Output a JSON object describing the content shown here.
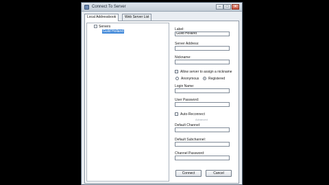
{
  "window": {
    "title": "Connect To Server",
    "min_glyph": "–",
    "max_glyph": "□",
    "close_glyph": "✕"
  },
  "tabs": [
    {
      "label": "Local Addressbook",
      "active": true
    },
    {
      "label": "Web Server List",
      "active": false
    }
  ],
  "tree": {
    "root_label": "Servers",
    "expander_glyph": "−",
    "children": [
      "Guild Holland"
    ]
  },
  "form": {
    "label_label": "Label:",
    "label_value": "Guild Holland",
    "server_address_label": "Server Address:",
    "server_address_value": "",
    "nickname_label": "Nickname:",
    "nickname_value": "",
    "allow_assign_label": "Allow server to assign a nickname",
    "anonymous_label": "Anonymous",
    "registered_label": "Registered",
    "login_name_label": "Login Name:",
    "login_name_value": "",
    "user_password_label": "User Password:",
    "user_password_value": "",
    "auto_reconnect_label": "Auto-Reconnect",
    "advanced_label": "Advanced",
    "default_channel_label": "Default Channel:",
    "default_channel_value": "",
    "default_subchannel_label": "Default Subchannel:",
    "default_subchannel_value": "",
    "channel_password_label": "Channel Password:",
    "channel_password_value": ""
  },
  "buttons": {
    "connect": "Connect",
    "cancel": "Cancel"
  }
}
